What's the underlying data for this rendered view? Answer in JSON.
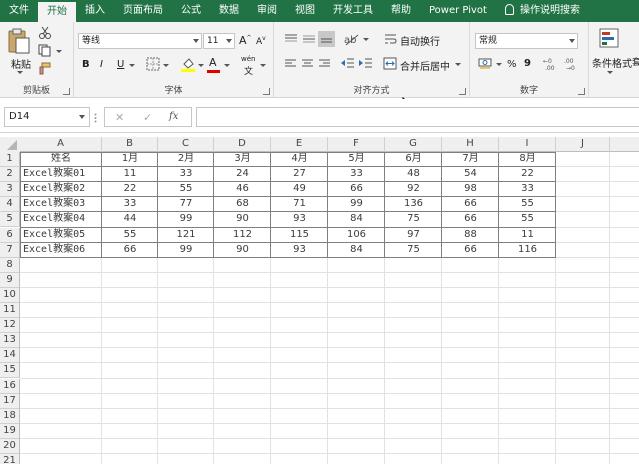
{
  "tabs": [
    "文件",
    "开始",
    "插入",
    "页面布局",
    "公式",
    "数据",
    "审阅",
    "视图",
    "开发工具",
    "帮助",
    "Power Pivot",
    "操作说明搜索"
  ],
  "active_tab": "开始",
  "ribbon": {
    "clipboard": {
      "paste_label": "粘贴",
      "group_label": "剪贴板"
    },
    "font": {
      "font_name": "等线",
      "font_size": "11",
      "bold": "B",
      "italic": "I",
      "underline": "U",
      "group_label": "字体",
      "grow": "A",
      "shrink": "A",
      "font_color": "A",
      "pinyin": "wén"
    },
    "alignment": {
      "wrap_label": "自动换行",
      "merge_label": "合并后居中",
      "group_label": "对齐方式"
    },
    "number": {
      "format_value": "常规",
      "percent": "%",
      "comma": "9",
      "group_label": "数字"
    },
    "styles": {
      "conditional_label": "条件格式",
      "group_label_partial": "套"
    }
  },
  "formula_bar": {
    "name_box": "D14",
    "cancel": "✕",
    "enter": "✓",
    "fx": "fx",
    "value": ""
  },
  "columns": [
    "A",
    "B",
    "C",
    "D",
    "E",
    "F",
    "G",
    "H",
    "I",
    "J"
  ],
  "rows": [
    "1",
    "2",
    "3",
    "4",
    "5",
    "6",
    "7",
    "8",
    "9",
    "10",
    "11",
    "12",
    "13",
    "14",
    "15",
    "16",
    "17",
    "18",
    "19",
    "20",
    "21"
  ],
  "table": {
    "header": [
      "姓名",
      "1月",
      "2月",
      "3月",
      "4月",
      "5月",
      "6月",
      "7月",
      "8月"
    ],
    "rows": [
      [
        "Excel教案01",
        "11",
        "33",
        "24",
        "27",
        "33",
        "48",
        "54",
        "22"
      ],
      [
        "Excel教案02",
        "22",
        "55",
        "46",
        "49",
        "66",
        "92",
        "98",
        "33"
      ],
      [
        "Excel教案03",
        "33",
        "77",
        "68",
        "71",
        "99",
        "136",
        "66",
        "55"
      ],
      [
        "Excel教案04",
        "44",
        "99",
        "90",
        "93",
        "84",
        "75",
        "66",
        "55"
      ],
      [
        "Excel教案05",
        "55",
        "121",
        "112",
        "115",
        "106",
        "97",
        "88",
        "11"
      ],
      [
        "Excel教案06",
        "66",
        "99",
        "90",
        "93",
        "84",
        "75",
        "66",
        "116"
      ]
    ]
  },
  "colors": {
    "ribbon_green": "#217346",
    "grid_border": "#7f7f7f"
  }
}
